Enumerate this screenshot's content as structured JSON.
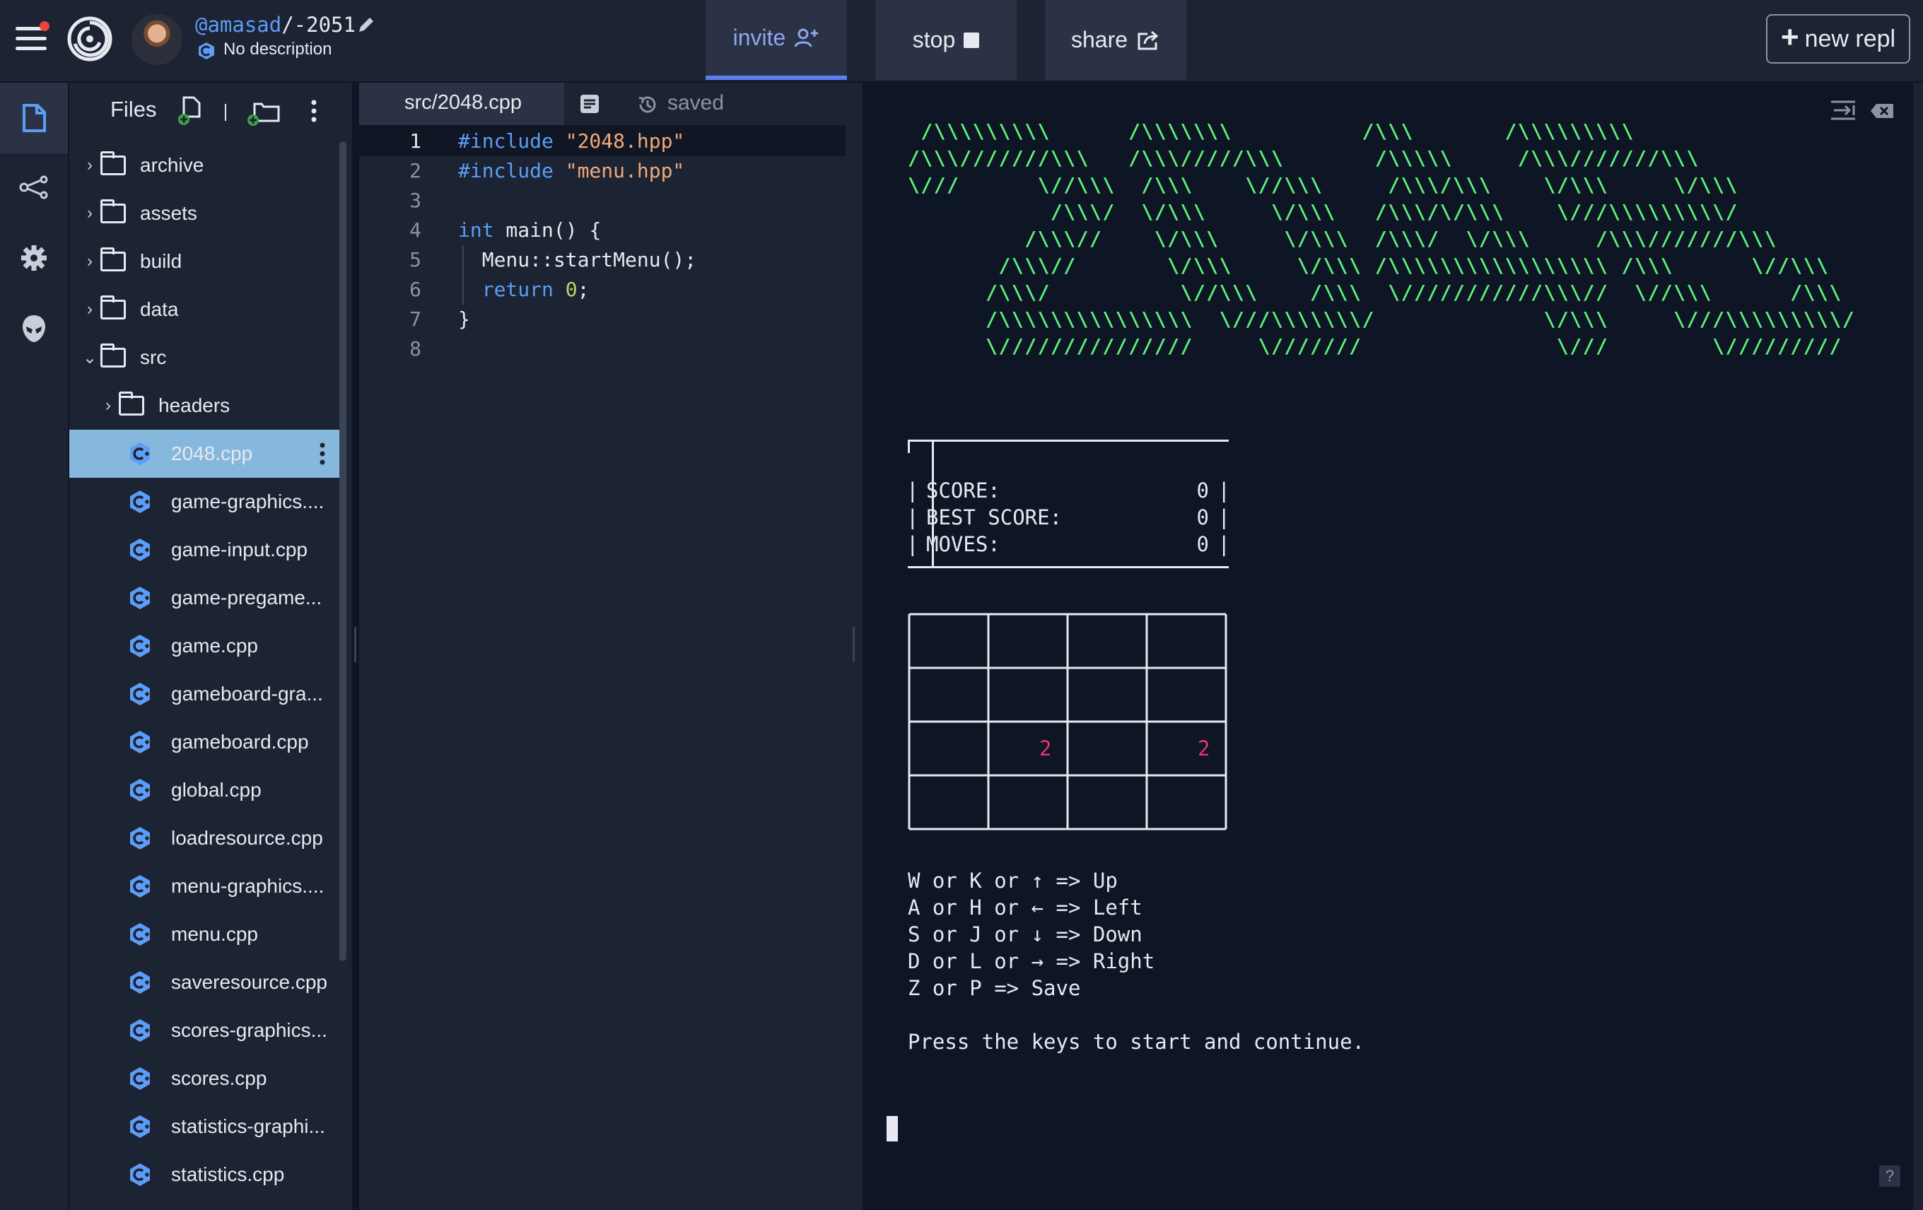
{
  "header": {
    "owner": "@amasad",
    "repl_name": "/-2051",
    "description": "No description",
    "tabs": {
      "invite": "invite",
      "stop": "stop",
      "share": "share"
    },
    "new_repl_label": "new repl",
    "new_repl_plus": "+"
  },
  "files": {
    "title": "Files",
    "tree": [
      {
        "name": "archive",
        "kind": "folder",
        "expanded": false,
        "depth": 0
      },
      {
        "name": "assets",
        "kind": "folder",
        "expanded": false,
        "depth": 0
      },
      {
        "name": "build",
        "kind": "folder",
        "expanded": false,
        "depth": 0
      },
      {
        "name": "data",
        "kind": "folder",
        "expanded": false,
        "depth": 0
      },
      {
        "name": "src",
        "kind": "folder",
        "expanded": true,
        "depth": 0
      },
      {
        "name": "headers",
        "kind": "folder",
        "expanded": false,
        "depth": 1
      },
      {
        "name": "2048.cpp",
        "kind": "file",
        "selected": true
      },
      {
        "name": "game-graphics....",
        "kind": "file"
      },
      {
        "name": "game-input.cpp",
        "kind": "file"
      },
      {
        "name": "game-pregame...",
        "kind": "file"
      },
      {
        "name": "game.cpp",
        "kind": "file"
      },
      {
        "name": "gameboard-gra...",
        "kind": "file"
      },
      {
        "name": "gameboard.cpp",
        "kind": "file"
      },
      {
        "name": "global.cpp",
        "kind": "file"
      },
      {
        "name": "loadresource.cpp",
        "kind": "file"
      },
      {
        "name": "menu-graphics....",
        "kind": "file"
      },
      {
        "name": "menu.cpp",
        "kind": "file"
      },
      {
        "name": "saveresource.cpp",
        "kind": "file"
      },
      {
        "name": "scores-graphics...",
        "kind": "file"
      },
      {
        "name": "scores.cpp",
        "kind": "file"
      },
      {
        "name": "statistics-graphi...",
        "kind": "file"
      },
      {
        "name": "statistics.cpp",
        "kind": "file"
      }
    ]
  },
  "editor": {
    "tab_label": "src/2048.cpp",
    "status": "saved",
    "active_line": 1,
    "lines": [
      [
        {
          "t": "#include ",
          "c": "kw"
        },
        {
          "t": "\"2048.hpp\"",
          "c": "str"
        }
      ],
      [
        {
          "t": "#include ",
          "c": "kw"
        },
        {
          "t": "\"menu.hpp\"",
          "c": "str"
        }
      ],
      [],
      [
        {
          "t": "int",
          "c": "kw"
        },
        {
          "t": " main() {",
          "c": "plain"
        }
      ],
      [
        {
          "t": "  Menu::startMenu();",
          "c": "plain"
        }
      ],
      [
        {
          "t": "  ",
          "c": "plain"
        },
        {
          "t": "return",
          "c": "kw"
        },
        {
          "t": " ",
          "c": "plain"
        },
        {
          "t": "0",
          "c": "num"
        },
        {
          "t": ";",
          "c": "plain"
        }
      ],
      [
        {
          "t": "}",
          "c": "plain"
        }
      ],
      []
    ]
  },
  "console": {
    "ascii_art": " /\\\\\\\\\\\\\\\\\\      /\\\\\\\\\\\\\\          /\\\\\\       /\\\\\\\\\\\\\\\\\\\n/\\\\\\///////\\\\\\   /\\\\\\/////\\\\\\       /\\\\\\\\\\     /\\\\\\///////\\\\\\\n\\///      \\//\\\\\\  /\\\\\\    \\//\\\\\\     /\\\\\\/\\\\\\    \\/\\\\\\     \\/\\\\\\\n           /\\\\\\/  \\/\\\\\\     \\/\\\\\\   /\\\\\\/\\/\\\\\\    \\///\\\\\\\\\\\\\\\\\\/\n         /\\\\\\//    \\/\\\\\\     \\/\\\\\\  /\\\\\\/  \\/\\\\\\     /\\\\\\///////\\\\\\\n       /\\\\\\//       \\/\\\\\\     \\/\\\\\\ /\\\\\\\\\\\\\\\\\\\\\\\\\\\\\\\\\\ /\\\\\\      \\//\\\\\\\n      /\\\\\\/          \\//\\\\\\    /\\\\\\  \\///////////\\\\\\//  \\//\\\\\\      /\\\\\\\n      /\\\\\\\\\\\\\\\\\\\\\\\\\\\\\\  \\///\\\\\\\\\\\\\\/             \\/\\\\\\     \\///\\\\\\\\\\\\\\\\\\/\n      \\///////////////     \\///////               \\///        \\/////////",
    "score": {
      "score_label": "SCORE:",
      "score_value": "0",
      "best_label": "BEST SCORE:",
      "best_value": "0",
      "moves_label": "MOVES:",
      "moves_value": "0"
    },
    "board": [
      [
        "",
        "",
        "",
        ""
      ],
      [
        "",
        "",
        "",
        ""
      ],
      [
        "",
        "2",
        "",
        "2"
      ],
      [
        "",
        "",
        "",
        ""
      ]
    ],
    "controls": [
      "W or K or ↑ => Up",
      "A or H or ← => Left",
      "S or J or ↓ => Down",
      "D or L or → => Right",
      "Z or P => Save"
    ],
    "prompt": "Press the keys to start and continue.",
    "help": "?"
  },
  "colors": {
    "background": "#0e1525",
    "panel": "#1c2333",
    "accent": "#5c9df5",
    "selection": "#86b8dd",
    "ascii_green": "#5ef27a",
    "tile_red": "#e8336b"
  },
  "icons": {
    "menu": "hamburger-icon",
    "logo": "replit-spiral-icon",
    "edit": "pencil-icon",
    "lang": "cpp-icon",
    "invite": "add-user-icon",
    "stop": "stop-square-icon",
    "share": "share-icon",
    "rail": [
      "files-icon",
      "share-nodes-icon",
      "gear-icon",
      "alien-icon"
    ]
  }
}
